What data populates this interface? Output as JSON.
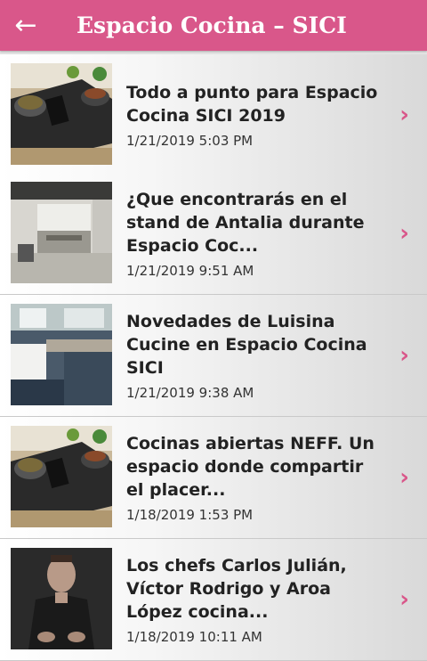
{
  "header": {
    "title": "Espacio Cocina – SICI",
    "back_icon": "arrow-left-icon",
    "accent_color": "#d9578a"
  },
  "articles": [
    {
      "title": "Todo a punto para Espacio Cocina SICI 2019",
      "date": "1/21/2019 5:03 PM",
      "thumb_icon": "cooktop-photo"
    },
    {
      "title": "¿Que encontrarás en el stand de Antalia durante Espacio Coc...",
      "date": "1/21/2019 9:51 AM",
      "thumb_icon": "kitchen-interior-photo"
    },
    {
      "title": "Novedades de Luisina Cucine en Espacio Cocina SICI",
      "date": "1/21/2019 9:38 AM",
      "thumb_icon": "kitchen-sink-photo"
    },
    {
      "title": "Cocinas abiertas NEFF. Un espacio donde compartir el placer...",
      "date": "1/18/2019 1:53 PM",
      "thumb_icon": "cooktop-photo"
    },
    {
      "title": "Los chefs Carlos Julián, Víctor Rodrigo y Aroa López cocina...",
      "date": "1/18/2019 10:11 AM",
      "thumb_icon": "chef-photo"
    }
  ]
}
